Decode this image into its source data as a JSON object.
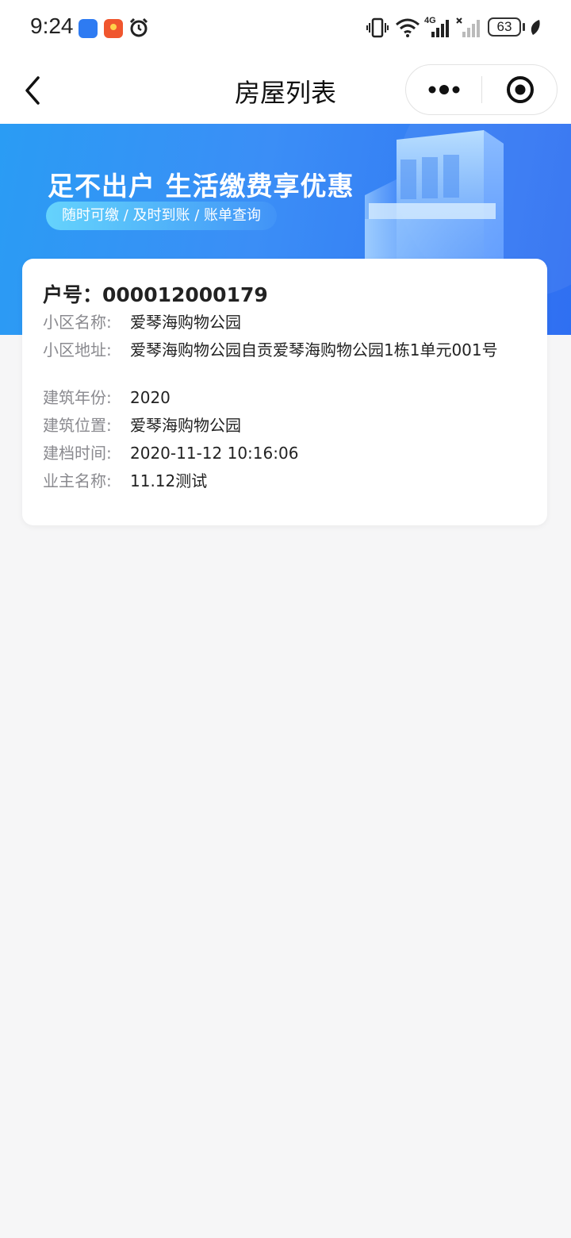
{
  "status_bar": {
    "time": "9:24",
    "battery": "63",
    "network": "4G",
    "icons": [
      "app-icon",
      "app-icon",
      "alarm-icon",
      "vibrate-icon",
      "wifi-icon",
      "signal-icon",
      "signal-off-icon",
      "battery-icon",
      "leaf-icon"
    ]
  },
  "nav": {
    "title": "房屋列表",
    "back_icon": "chevron-left-icon",
    "more_icon": "more-dots-icon",
    "close_icon": "target-icon"
  },
  "banner": {
    "headline": "足不出户 生活缴费享优惠",
    "tagline": "随时可缴 / 及时到账 / 账单查询",
    "colors": {
      "start": "#2a9cf4",
      "end": "#2f6ff2"
    }
  },
  "house": {
    "account_label": "户号：",
    "account_number": "000012000179",
    "fields": [
      {
        "label": "小区名称:",
        "value": "爱琴海购物公园"
      },
      {
        "label": "小区地址:",
        "value": "爱琴海购物公园自贡爱琴海购物公园1栋1单元001号"
      },
      {
        "label": "建筑年份:",
        "value": "2020"
      },
      {
        "label": "建筑位置:",
        "value": "爱琴海购物公园"
      },
      {
        "label": "建档时间:",
        "value": "2020-11-12 10:16:06"
      },
      {
        "label": "业主名称:",
        "value": "11.12测试"
      }
    ]
  }
}
